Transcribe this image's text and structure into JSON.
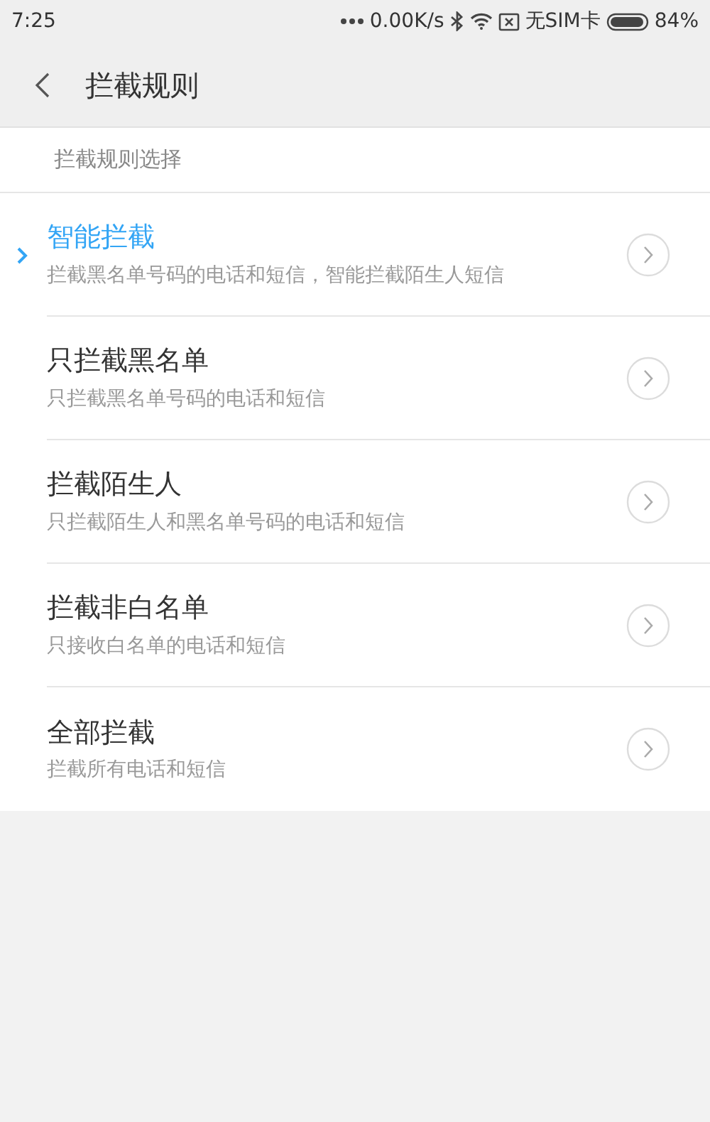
{
  "status_bar": {
    "time": "7:25",
    "speed": "0.00K/s",
    "sim": "无SIM卡",
    "battery": "84%"
  },
  "header": {
    "title": "拦截规则"
  },
  "section": {
    "title": "拦截规则选择"
  },
  "rules": [
    {
      "title": "智能拦截",
      "subtitle": "拦截黑名单号码的电话和短信，智能拦截陌生人短信",
      "selected": true
    },
    {
      "title": "只拦截黑名单",
      "subtitle": "只拦截黑名单号码的电话和短信",
      "selected": false
    },
    {
      "title": "拦截陌生人",
      "subtitle": "只拦截陌生人和黑名单号码的电话和短信",
      "selected": false
    },
    {
      "title": "拦截非白名单",
      "subtitle": "只接收白名单的电话和短信",
      "selected": false
    },
    {
      "title": "全部拦截",
      "subtitle": "拦截所有电话和短信",
      "selected": false
    }
  ]
}
